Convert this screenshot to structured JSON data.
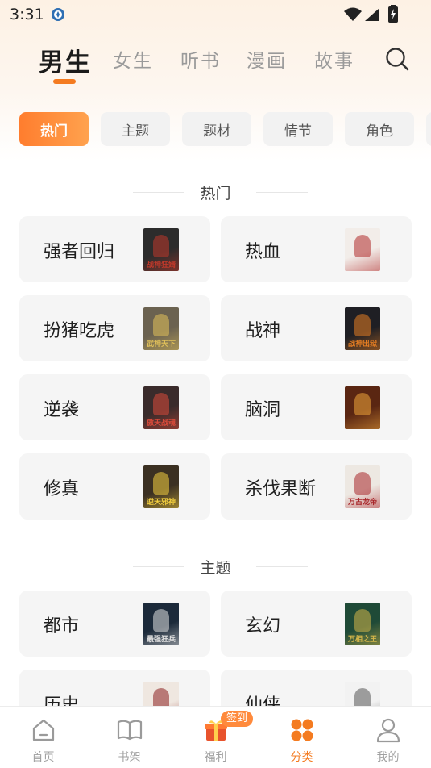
{
  "status": {
    "time": "3:31"
  },
  "tabs": [
    {
      "label": "男生",
      "active": true
    },
    {
      "label": "女生"
    },
    {
      "label": "听书"
    },
    {
      "label": "漫画"
    },
    {
      "label": "故事"
    }
  ],
  "chips": [
    {
      "label": "热门",
      "active": true
    },
    {
      "label": "主题"
    },
    {
      "label": "题材"
    },
    {
      "label": "情节"
    },
    {
      "label": "角色"
    }
  ],
  "sections": [
    {
      "title": "热门",
      "items": [
        {
          "label": "强者回归",
          "cover_text": "战神狂婿",
          "cover_color": "#2c2c2c",
          "cover_accent": "#c0392b"
        },
        {
          "label": "热血",
          "cover_text": "",
          "cover_color": "#f2ede9",
          "cover_accent": "#b02a2a"
        },
        {
          "label": "扮猪吃虎",
          "cover_text": "武神天下",
          "cover_color": "#6b6250",
          "cover_accent": "#e1c15a"
        },
        {
          "label": "战神",
          "cover_text": "战神出狱",
          "cover_color": "#1f1f24",
          "cover_accent": "#e67e22"
        },
        {
          "label": "逆袭",
          "cover_text": "傲天战魂",
          "cover_color": "#3a2b2b",
          "cover_accent": "#d94a3a"
        },
        {
          "label": "脑洞",
          "cover_text": "",
          "cover_color": "#5a2612",
          "cover_accent": "#f0a63b"
        },
        {
          "label": "修真",
          "cover_text": "逆天邪神",
          "cover_color": "#3b3022",
          "cover_accent": "#f4d03f"
        },
        {
          "label": "杀伐果断",
          "cover_text": "万古龙帝",
          "cover_color": "#ede8e2",
          "cover_accent": "#a8262a"
        }
      ]
    },
    {
      "title": "主题",
      "items": [
        {
          "label": "都市",
          "cover_text": "最强狂兵",
          "cover_color": "#1c2a3a",
          "cover_accent": "#e0e0e0"
        },
        {
          "label": "玄幻",
          "cover_text": "万相之王",
          "cover_color": "#1f4a37",
          "cover_accent": "#d4b64a"
        },
        {
          "label": "历史",
          "cover_text": "",
          "cover_color": "#efe7e0",
          "cover_accent": "#8a1f1f"
        },
        {
          "label": "仙侠",
          "cover_text": "",
          "cover_color": "#f2f2f2",
          "cover_accent": "#555555"
        }
      ]
    }
  ],
  "bottom_nav": [
    {
      "label": "首页",
      "icon": "home-icon"
    },
    {
      "label": "书架",
      "icon": "book-icon"
    },
    {
      "label": "福利",
      "icon": "gift-icon",
      "badge": "签到"
    },
    {
      "label": "分类",
      "icon": "category-icon",
      "active": true
    },
    {
      "label": "我的",
      "icon": "user-icon"
    }
  ],
  "colors": {
    "accent": "#f47b20",
    "card_bg": "#f5f5f5",
    "chip_bg": "#f2f2f2"
  }
}
